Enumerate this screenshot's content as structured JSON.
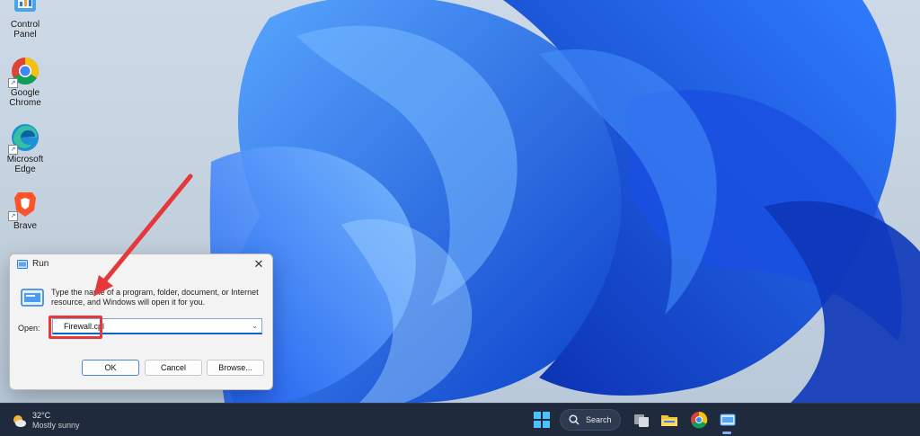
{
  "desktop": {
    "icons": [
      {
        "label": "Control Panel",
        "icon": "control-panel-icon"
      },
      {
        "label": "Google Chrome",
        "icon": "chrome-icon"
      },
      {
        "label": "Microsoft Edge",
        "icon": "edge-icon"
      },
      {
        "label": "Brave",
        "icon": "brave-icon"
      }
    ]
  },
  "run_dialog": {
    "title": "Run",
    "close_glyph": "✕",
    "description": "Type the name of a program, folder, document, or Internet resource, and Windows will open it for you.",
    "open_label": "Open:",
    "input_value": "Firewall.cpl",
    "buttons": {
      "ok": "OK",
      "cancel": "Cancel",
      "browse": "Browse..."
    }
  },
  "taskbar": {
    "weather": {
      "temp": "32°C",
      "condition": "Mostly sunny"
    },
    "search_label": "Search",
    "apps": [
      "start-icon",
      "search-icon",
      "task-view-icon",
      "file-explorer-icon",
      "chrome-icon",
      "run-icon"
    ]
  },
  "colors": {
    "highlight": "#e5383b",
    "accent": "#0a64c9",
    "taskbar": "#1f2a3c"
  }
}
